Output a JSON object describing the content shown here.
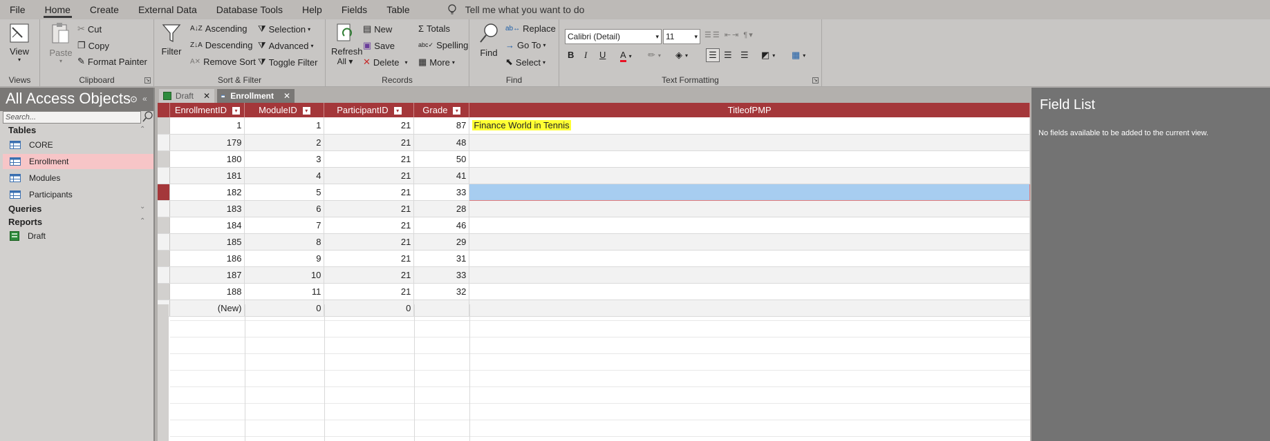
{
  "menu": {
    "items": [
      "File",
      "Home",
      "Create",
      "External Data",
      "Database Tools",
      "Help",
      "Fields",
      "Table"
    ],
    "active": "Home",
    "tell_me": "Tell me what you want to do"
  },
  "ribbon": {
    "views": {
      "label": "Views",
      "view": "View"
    },
    "clipboard": {
      "label": "Clipboard",
      "paste": "Paste",
      "cut": "Cut",
      "copy": "Copy",
      "format_painter": "Format Painter"
    },
    "sort_filter": {
      "label": "Sort & Filter",
      "filter": "Filter",
      "ascending": "Ascending",
      "descending": "Descending",
      "remove_sort": "Remove Sort",
      "selection": "Selection",
      "advanced": "Advanced",
      "toggle_filter": "Toggle Filter"
    },
    "records": {
      "label": "Records",
      "refresh_all": "Refresh",
      "refresh_all_2": "All",
      "new": "New",
      "save": "Save",
      "delete": "Delete",
      "totals": "Totals",
      "spelling": "Spelling",
      "more": "More"
    },
    "find": {
      "label": "Find",
      "find": "Find",
      "replace": "Replace",
      "go_to": "Go To",
      "select": "Select"
    },
    "text_formatting": {
      "label": "Text Formatting",
      "font": "Calibri (Detail)",
      "size": "11"
    }
  },
  "nav": {
    "title": "All Access Objects",
    "search_placeholder": "Search...",
    "tables_header": "Tables",
    "tables": [
      "CORE",
      "Enrollment",
      "Modules",
      "Participants"
    ],
    "selected_table": "Enrollment",
    "queries_header": "Queries",
    "reports_header": "Reports",
    "reports": [
      "Draft"
    ]
  },
  "doc_tabs": [
    {
      "label": "Draft",
      "active": false
    },
    {
      "label": "Enrollment",
      "active": true
    }
  ],
  "datasheet": {
    "columns": [
      "EnrollmentID",
      "ModuleID",
      "ParticipantID",
      "Grade",
      "TitleofPMP"
    ],
    "rows": [
      [
        "1",
        "1",
        "21",
        "87",
        "Finance World in Tennis"
      ],
      [
        "179",
        "2",
        "21",
        "48",
        ""
      ],
      [
        "180",
        "3",
        "21",
        "50",
        ""
      ],
      [
        "181",
        "4",
        "21",
        "41",
        ""
      ],
      [
        "182",
        "5",
        "21",
        "33",
        ""
      ],
      [
        "183",
        "6",
        "21",
        "28",
        ""
      ],
      [
        "184",
        "7",
        "21",
        "46",
        ""
      ],
      [
        "185",
        "8",
        "21",
        "29",
        ""
      ],
      [
        "186",
        "9",
        "21",
        "31",
        ""
      ],
      [
        "187",
        "10",
        "21",
        "33",
        ""
      ],
      [
        "188",
        "11",
        "21",
        "32",
        ""
      ]
    ],
    "new_row": [
      "(New)",
      "0",
      "0",
      "",
      ""
    ],
    "current_row_index": 4,
    "highlight_color": "#ffff33"
  },
  "field_list": {
    "title": "Field List",
    "message": "No fields available to be added to the current view."
  }
}
